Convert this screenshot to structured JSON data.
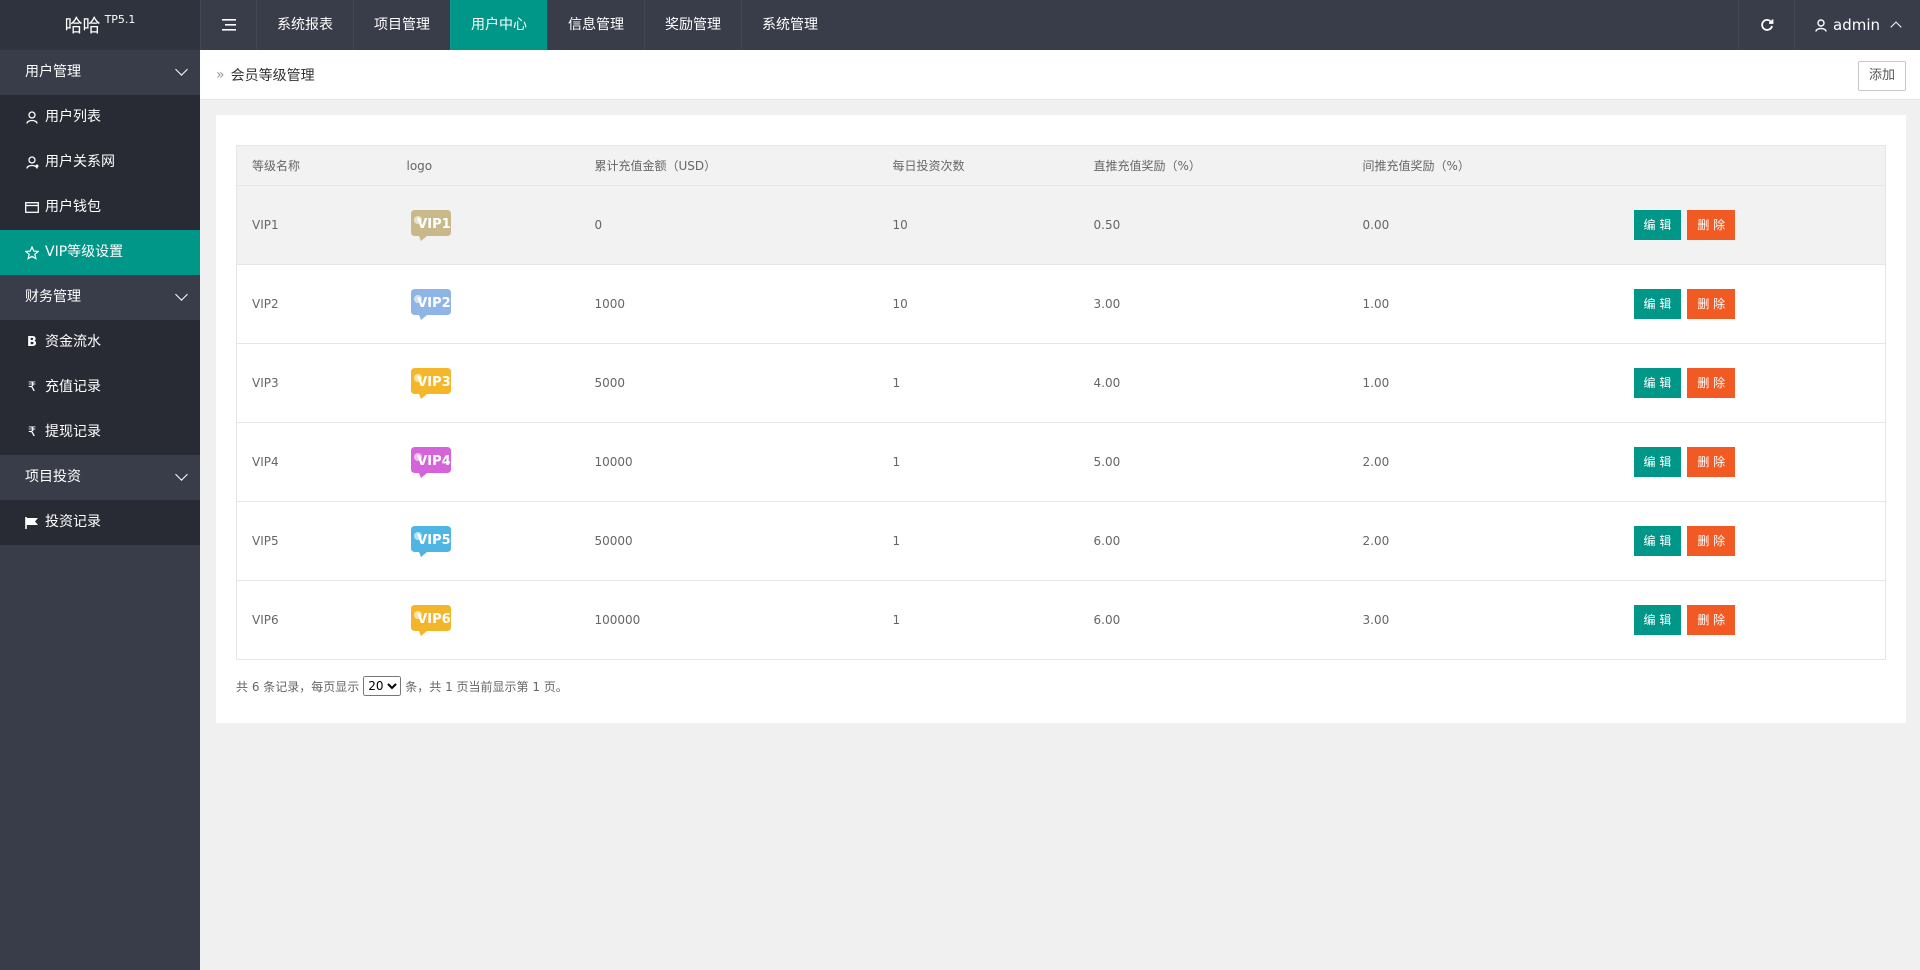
{
  "app": {
    "logo_text": "哈哈",
    "logo_version": "TP5.1"
  },
  "header": {
    "menu_icon": "menu-icon",
    "nav": [
      {
        "label": "系统报表"
      },
      {
        "label": "项目管理"
      },
      {
        "label": "用户中心",
        "active": true
      },
      {
        "label": "信息管理"
      },
      {
        "label": "奖励管理"
      },
      {
        "label": "系统管理"
      }
    ],
    "refresh_icon": "refresh-icon",
    "user": "admin"
  },
  "sidebar": {
    "groups": [
      {
        "label": "用户管理",
        "items": [
          {
            "label": "用户列表",
            "icon": "user-icon"
          },
          {
            "label": "用户关系网",
            "icon": "user-network-icon"
          },
          {
            "label": "用户钱包",
            "icon": "wallet-icon"
          },
          {
            "label": "VIP等级设置",
            "icon": "star-icon",
            "active": true
          }
        ]
      },
      {
        "label": "财务管理",
        "items": [
          {
            "label": "资金流水",
            "icon": "bitcoin-icon"
          },
          {
            "label": "充值记录",
            "icon": "rupee-icon"
          },
          {
            "label": "提现记录",
            "icon": "rupee-icon"
          }
        ]
      },
      {
        "label": "项目投资",
        "items": [
          {
            "label": "投资记录",
            "icon": "flag-icon"
          }
        ]
      }
    ]
  },
  "breadcrumb": {
    "icon": "double-chevron-right-icon",
    "text": "会员等级管理"
  },
  "toolbar": {
    "add_label": "添加"
  },
  "table": {
    "columns": [
      "等级名称",
      "logo",
      "累计充值金额（USD）",
      "每日投资次数",
      "直推充值奖励（%）",
      "间推充值奖励（%）",
      ""
    ],
    "edit_label": "编 辑",
    "delete_label": "删 除",
    "rows": [
      {
        "name": "VIP1",
        "logo_text": "VIP1",
        "logo_color": "#c9b98a",
        "amount": "0",
        "daily": "10",
        "direct": "0.50",
        "indirect": "0.00"
      },
      {
        "name": "VIP2",
        "logo_text": "VIP2",
        "logo_color": "#8fb4e6",
        "amount": "1000",
        "daily": "10",
        "direct": "3.00",
        "indirect": "1.00"
      },
      {
        "name": "VIP3",
        "logo_text": "VIP3",
        "logo_color": "#f5b72a",
        "amount": "5000",
        "daily": "1",
        "direct": "4.00",
        "indirect": "1.00"
      },
      {
        "name": "VIP4",
        "logo_text": "VIP4",
        "logo_color": "#d563d9",
        "amount": "10000",
        "daily": "1",
        "direct": "5.00",
        "indirect": "2.00"
      },
      {
        "name": "VIP5",
        "logo_text": "VIP5",
        "logo_color": "#4fb6e3",
        "amount": "50000",
        "daily": "1",
        "direct": "6.00",
        "indirect": "2.00"
      },
      {
        "name": "VIP6",
        "logo_text": "VIP6",
        "logo_color": "#f3b52c",
        "amount": "100000",
        "daily": "1",
        "direct": "6.00",
        "indirect": "3.00"
      }
    ]
  },
  "pager": {
    "prefix": "共 6 条记录，每页显示",
    "per_page": "20",
    "suffix": "条，共 1 页当前显示第 1 页。"
  },
  "colors": {
    "accent": "#009688",
    "danger": "#f15a22",
    "header_bg": "#393d49"
  }
}
